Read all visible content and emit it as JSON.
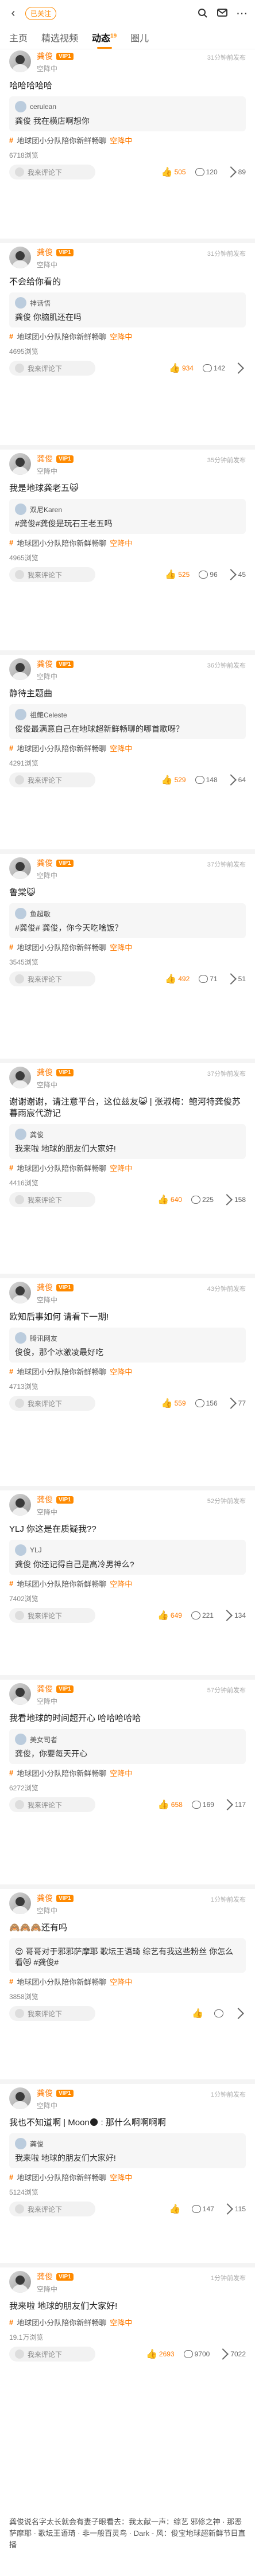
{
  "header": {
    "back_label": "‹",
    "pill": "已关注",
    "search_icon": "search-icon",
    "msg_icon": "message-icon",
    "more_icon": "more-icon"
  },
  "tabs": [
    {
      "label": "主页"
    },
    {
      "label": "精选视频"
    },
    {
      "label": "动态",
      "badge": "19"
    },
    {
      "label": "圈儿"
    }
  ],
  "author": {
    "name": "龚俊",
    "vip": "VIP1",
    "sub": "空降中"
  },
  "topic_default": "地球团小分队陪你新鲜畅聊",
  "topic_ph": "空降中",
  "reply_label": "我来评论下",
  "posts": [
    {
      "time": "31分钟前发布",
      "body": "哈哈哈哈哈",
      "q_user": "cerulean",
      "q_text": "龚俊 我在横店啊想你",
      "views": "6718浏览",
      "likes": "505",
      "comments": "120",
      "shares": "89"
    },
    {
      "time": "31分钟前发布",
      "body": "不会给你看的",
      "q_user": "神话悟",
      "q_text": "龚俊 你脑肌还在吗",
      "views": "4695浏览",
      "likes": "934",
      "comments": "142",
      "shares": ""
    },
    {
      "time": "35分钟前发布",
      "body": "我是地球龚老五😺",
      "q_user": "双尼Karen",
      "q_text": "#龚俊#龚俊是玩石王老五吗",
      "views": "4965浏览",
      "likes": "525",
      "comments": "96",
      "shares": "45"
    },
    {
      "time": "36分钟前发布",
      "body": "静待主题曲",
      "q_user": "祖鲍Celeste",
      "q_text": "俊俊最满意自己在地球超新鲜畅聊的哪首歌呀？",
      "views": "4291浏览",
      "likes": "529",
      "comments": "148",
      "shares": "64"
    },
    {
      "time": "37分钟前发布",
      "body": "鲁棠😺",
      "q_user": "鱼超敏",
      "q_text": "#龚俊# 龚俊，你今天吃啥饭？",
      "views": "3545浏览",
      "likes": "492",
      "comments": "71",
      "shares": "51"
    },
    {
      "time": "37分钟前发布",
      "body": "谢谢谢谢，请注意平台，这位兹友😺 | 张淑梅：鲍河特龚俊苏暮雨宸代游记",
      "q_user": "龚俊",
      "q_text": "我来啦 地球的朋友们大家好!",
      "views": "4416浏览",
      "likes": "640",
      "comments": "225",
      "shares": "158"
    },
    {
      "time": "43分钟前发布",
      "body": "欧知后事如何 请看下一期!",
      "q_user": "腾讯网友",
      "q_text": "俊俊，那个冰激凌最好吃",
      "views": "4713浏览",
      "likes": "559",
      "comments": "156",
      "shares": "77"
    },
    {
      "time": "52分钟前发布",
      "body": "YLJ 你这是在质疑我??",
      "q_user": "YLJ",
      "q_text": "龚俊 你还记得自己是高冷男神么?",
      "views": "7402浏览",
      "likes": "649",
      "comments": "221",
      "shares": "134"
    },
    {
      "time": "57分钟前发布",
      "body": "我看地球的时间超开心 哈哈哈哈哈",
      "q_user": "美女司者",
      "q_text": "龚俊，你要每天开心",
      "views": "6272浏览",
      "likes": "658",
      "comments": "169",
      "shares": "117"
    },
    {
      "time": "1分钟前发布",
      "body": "🙈🙈🙈还有吗",
      "q_user": "",
      "q_text": "😍 哥哥对于邪邪萨摩耶 歌坛王语琦 综艺有我这些粉丝 你怎么看😻 #龚俊#",
      "views": "3858浏览",
      "likes": "",
      "comments": "",
      "shares": ""
    },
    {
      "time": "1分钟前发布",
      "body": "我也不知道啊 | Moon🌑 : 那什么啊啊啊啊",
      "q_user": "龚俊",
      "q_text": "我来啦 地球的朋友们大家好!",
      "views": "5124浏览",
      "likes": "",
      "comments": "147",
      "shares": "115"
    },
    {
      "time": "1分钟前发布",
      "body": "我来啦 地球的朋友们大家好!",
      "q_user": "",
      "q_text": "",
      "views": "19.1万浏览",
      "likes": "2693",
      "comments": "9700",
      "shares": "7022"
    }
  ],
  "footer": {
    "text": "龚俊说名字太长就会有妻子眼看去：我太献一声：综艺 邪修之神 · 那恶萨摩耶 · 歌坛王语琦 · 非一般百灵鸟 · Dark - 风：俊宝地球超新鲜节目直播"
  },
  "colors": {
    "accent": "#ff7a00",
    "vip": "#ff8a00"
  }
}
